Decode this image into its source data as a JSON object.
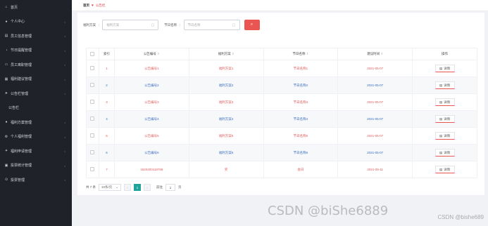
{
  "sidebar": {
    "items": [
      {
        "label": "首页",
        "icon": "home-icon",
        "has_arrow": false
      },
      {
        "label": "个人中心",
        "icon": "user-icon",
        "has_arrow": true
      },
      {
        "label": "员工信息管理",
        "icon": "building-icon",
        "has_arrow": true
      },
      {
        "label": "节日提醒管理",
        "icon": "bell-icon",
        "has_arrow": true
      },
      {
        "label": "员工离职管理",
        "icon": "briefcase-icon",
        "has_arrow": true
      },
      {
        "label": "福利建议管理",
        "icon": "gift-icon",
        "has_arrow": true
      },
      {
        "label": "公告栏管理",
        "icon": "send-icon",
        "has_arrow": true
      },
      {
        "label": "公告栏",
        "icon": "",
        "has_arrow": false,
        "sub": true
      },
      {
        "label": "福利方案管理",
        "icon": "user-icon",
        "has_arrow": true
      },
      {
        "label": "个人福利管理",
        "icon": "gear-icon",
        "has_arrow": true
      },
      {
        "label": "福利申请管理",
        "icon": "settings-icon",
        "has_arrow": true
      },
      {
        "label": "投票统计管理",
        "icon": "inbox-icon",
        "has_arrow": true
      },
      {
        "label": "投票管理",
        "icon": "pin-icon",
        "has_arrow": true
      }
    ]
  },
  "breadcrumb": {
    "home": "首页",
    "current": "公告栏"
  },
  "search": {
    "field1_label": "福利方案",
    "field1_placeholder": "福利方案",
    "field2_label": "节日名称",
    "field2_placeholder": "节日名称"
  },
  "table": {
    "headers": [
      "",
      "索引",
      "公告编号",
      "福利方案",
      "节日名称",
      "建议时间",
      "操作"
    ],
    "rows": [
      {
        "index": "1",
        "no": "公告编号1",
        "plan": "福利方案1",
        "holiday": "节日名称1",
        "time": "2021-05-07",
        "color": "red"
      },
      {
        "index": "2",
        "no": "公告编号2",
        "plan": "福利方案2",
        "holiday": "节日名称2",
        "time": "2021-05-07",
        "color": "blue"
      },
      {
        "index": "3",
        "no": "公告编号3",
        "plan": "福利方案3",
        "holiday": "节日名称3",
        "time": "2021-05-07",
        "color": "red"
      },
      {
        "index": "4",
        "no": "公告编号4",
        "plan": "福利方案4",
        "holiday": "节日名称4",
        "time": "2021-05-07",
        "color": "blue"
      },
      {
        "index": "5",
        "no": "公告编号5",
        "plan": "福利方案5",
        "holiday": "节日名称5",
        "time": "2021-05-07",
        "color": "red"
      },
      {
        "index": "6",
        "no": "公告编号6",
        "plan": "福利方案6",
        "holiday": "节日名称6",
        "time": "2021-05-07",
        "color": "blue"
      },
      {
        "index": "7",
        "no": "1620400118768",
        "plan": "奖",
        "holiday": "会日",
        "time": "2021-05-11",
        "color": "red"
      }
    ],
    "action_label": "详情"
  },
  "pagination": {
    "total": "共 7 条",
    "page_size": "10条/页",
    "current_page": "1",
    "goto_label": "前往",
    "goto_value": "1",
    "page_suffix": "页"
  },
  "watermark": {
    "text": "CSDN @biShe6889",
    "small": "CSDN @bishe689"
  },
  "colors": {
    "accent": "#e95550",
    "sidebar": "#1f2229",
    "pager_active": "#1fa39a"
  }
}
